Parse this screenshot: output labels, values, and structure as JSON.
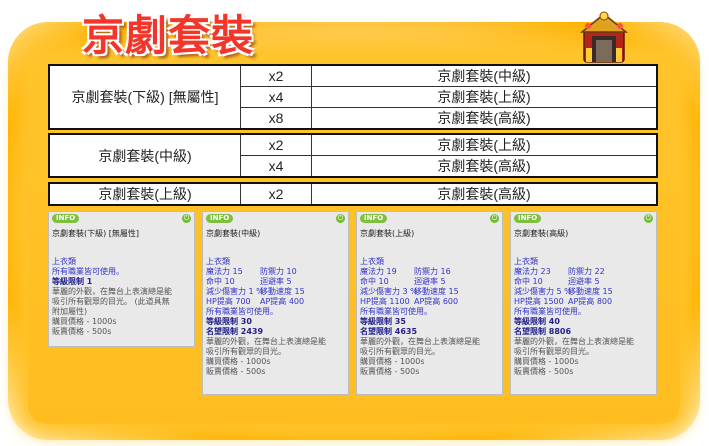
{
  "title": "京劇套裝",
  "groups": [
    {
      "name": "京劇套裝(下級) [無屬性]",
      "rows": [
        {
          "count": "x2",
          "result": "京劇套裝(中級)"
        },
        {
          "count": "x4",
          "result": "京劇套裝(上級)"
        },
        {
          "count": "x8",
          "result": "京劇套裝(高級)"
        }
      ]
    },
    {
      "name": "京劇套裝(中級)",
      "rows": [
        {
          "count": "x2",
          "result": "京劇套裝(上級)"
        },
        {
          "count": "x4",
          "result": "京劇套裝(高級)"
        }
      ]
    },
    {
      "name": "京劇套裝(上級)",
      "rows": [
        {
          "count": "x2",
          "result": "京劇套裝(高級)"
        }
      ]
    }
  ],
  "cards": [
    {
      "badge": "INFO",
      "name": "京劇套裝(下級) [無屬性]",
      "category": "上衣類",
      "lines": [
        {
          "t": "所有職業皆可使用。",
          "c": "blue"
        },
        {
          "t": "等級限制 1",
          "c": "navy"
        },
        {
          "t": "華麗的外觀，在舞台上表演總是能",
          "c": "grey"
        },
        {
          "t": "吸引所有觀眾的目光。 (此道具無",
          "c": "grey"
        },
        {
          "t": "附加屬性)",
          "c": "grey"
        },
        {
          "t": "購買價格 - 1000s",
          "c": "grey"
        },
        {
          "t": "販賣價格 - 500s",
          "c": "grey"
        }
      ]
    },
    {
      "badge": "INFO",
      "name": "京劇套裝(中級)",
      "category": "上衣類",
      "stats": [
        [
          "魔法力 15",
          "防禦力 10"
        ],
        [
          "命中 10",
          "迴避率 5"
        ],
        [
          "減少傷害力 1 %",
          "移動速度 15"
        ],
        [
          "HP提高 700",
          "AP提高 400"
        ]
      ],
      "lines": [
        {
          "t": "所有職業皆可使用。",
          "c": "blue"
        },
        {
          "t": "等級限制 30",
          "c": "navy"
        },
        {
          "t": "名望限制 2439",
          "c": "navy"
        },
        {
          "t": "華麗的外觀，在舞台上表演總是能",
          "c": "grey"
        },
        {
          "t": "吸引所有觀眾的目光。",
          "c": "grey"
        },
        {
          "t": "購買價格 - 1000s",
          "c": "grey"
        },
        {
          "t": "販賣價格 - 500s",
          "c": "grey"
        }
      ]
    },
    {
      "badge": "INFO",
      "name": "京劇套裝(上級)",
      "category": "上衣類",
      "stats": [
        [
          "魔法力 19",
          "防禦力 16"
        ],
        [
          "命中 10",
          "迴避率 5"
        ],
        [
          "減少傷害力 3 %",
          "移動速度 15"
        ],
        [
          "HP提高 1100",
          "AP提高 600"
        ]
      ],
      "lines": [
        {
          "t": "所有職業皆可使用。",
          "c": "blue"
        },
        {
          "t": "等級限制 35",
          "c": "navy"
        },
        {
          "t": "名望限制 4635",
          "c": "navy"
        },
        {
          "t": "華麗的外觀，在舞台上表演總是能",
          "c": "grey"
        },
        {
          "t": "吸引所有觀眾的目光。",
          "c": "grey"
        },
        {
          "t": "購買價格 - 1000s",
          "c": "grey"
        },
        {
          "t": "販賣價格 - 500s",
          "c": "grey"
        }
      ]
    },
    {
      "badge": "INFO",
      "name": "京劇套裝(高級)",
      "category": "上衣類",
      "stats": [
        [
          "魔法力 23",
          "防禦力 22"
        ],
        [
          "命中 10",
          "迴避率 5"
        ],
        [
          "減少傷害力 5 %",
          "移動速度 15"
        ],
        [
          "HP提高 1500",
          "AP提高 800"
        ]
      ],
      "lines": [
        {
          "t": "所有職業皆可使用。",
          "c": "blue"
        },
        {
          "t": "等級限制 40",
          "c": "navy"
        },
        {
          "t": "名望限制 8806",
          "c": "navy"
        },
        {
          "t": "華麗的外觀，在舞台上表演總是能",
          "c": "grey"
        },
        {
          "t": "吸引所有觀眾的目光。",
          "c": "grey"
        },
        {
          "t": "購買價格 - 1000s",
          "c": "grey"
        },
        {
          "t": "販賣價格 - 500s",
          "c": "grey"
        }
      ]
    }
  ],
  "colors": {
    "accent": "#f4362a",
    "background": "#ffc42b",
    "info_badge": "#7fbf3f"
  },
  "icons": {
    "emblem": "opera-costume-icon",
    "power": "power-icon"
  }
}
